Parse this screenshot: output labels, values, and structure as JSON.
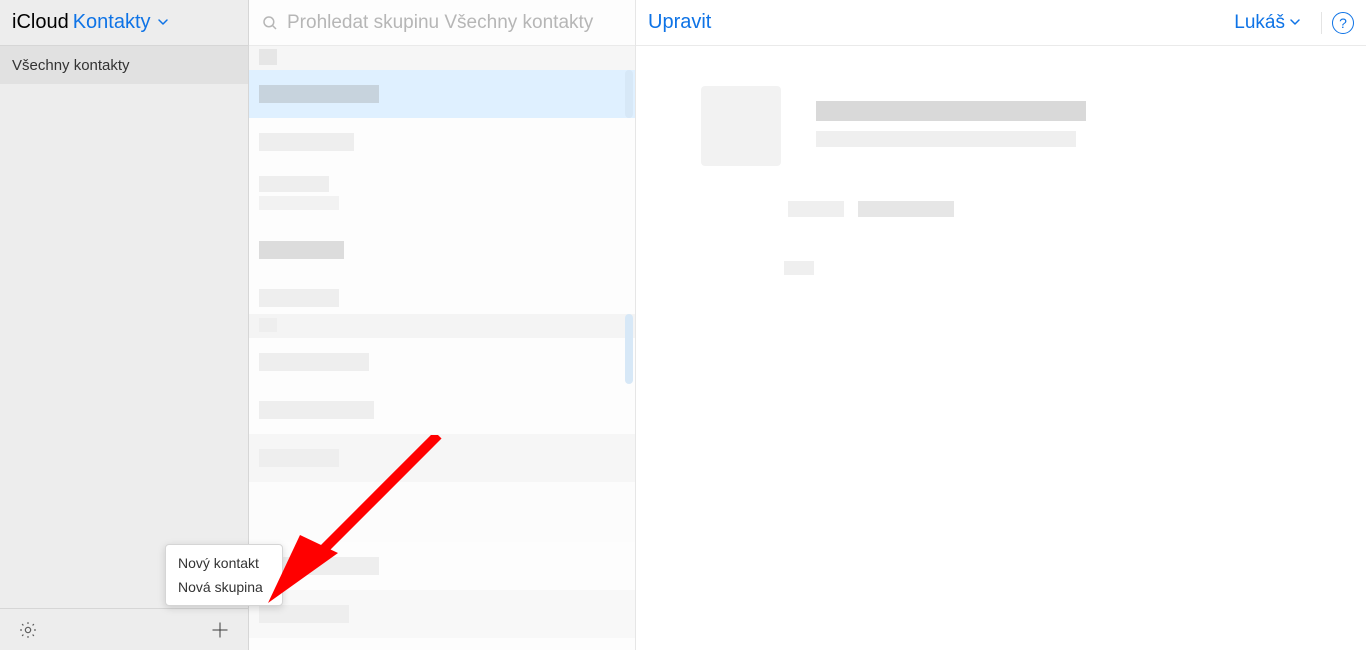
{
  "header": {
    "brand": "iCloud",
    "product": "Kontakty"
  },
  "sidebar": {
    "groups": [
      {
        "label": "Všechny kontakty",
        "selected": true
      }
    ]
  },
  "search": {
    "placeholder": "Prohledat skupinu Všechny kontakty"
  },
  "detail_header": {
    "edit": "Upravit",
    "user": "Lukáš"
  },
  "add_menu": {
    "new_contact": "Nový kontakt",
    "new_group": "Nová skupina"
  }
}
